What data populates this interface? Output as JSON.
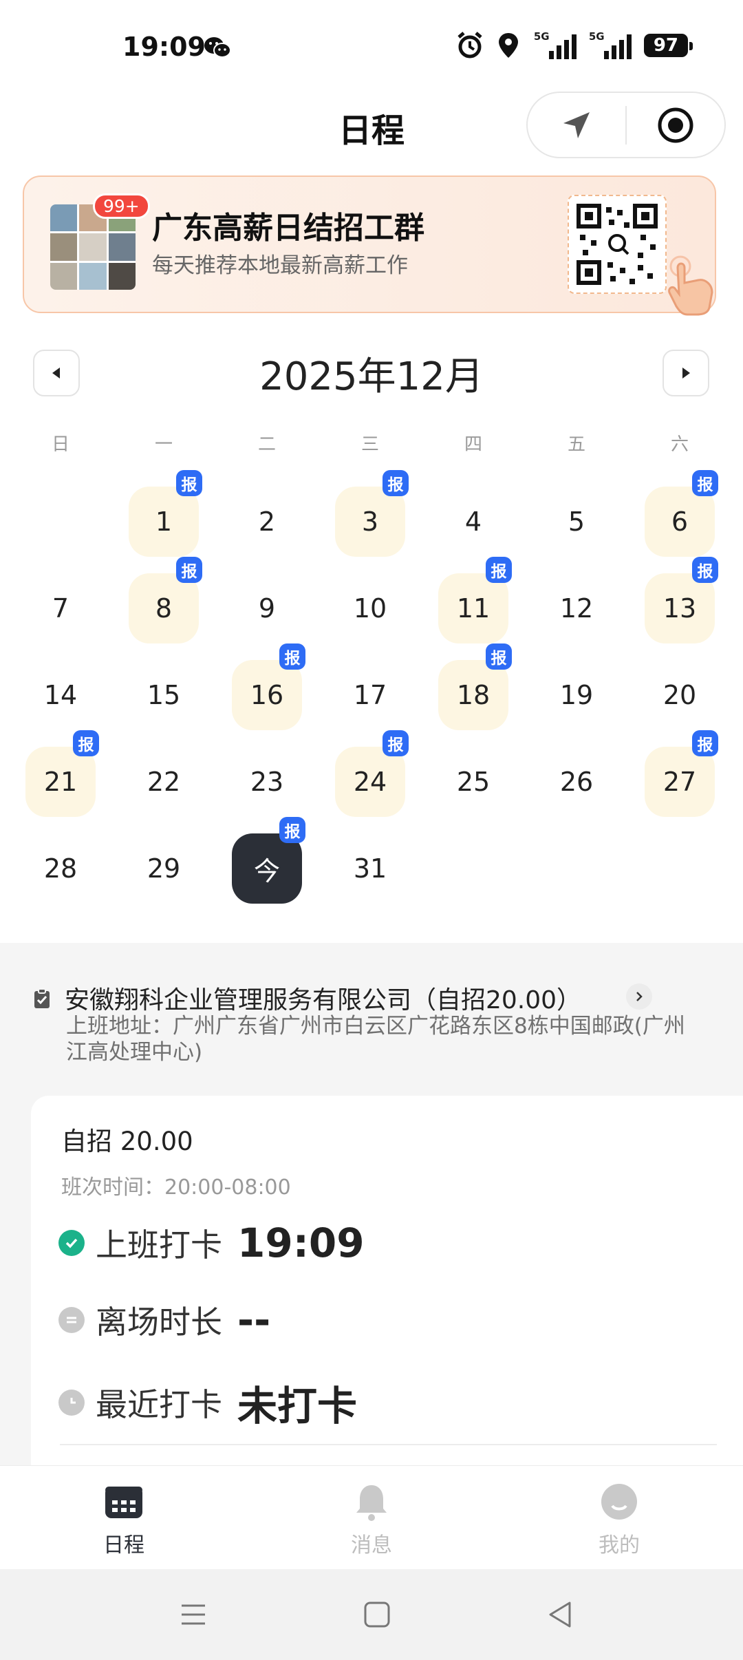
{
  "status_bar": {
    "time": "19:09",
    "icons": [
      "wechat-icon",
      "alarm-icon",
      "location-icon",
      "signal-5g-icon",
      "signal-5g-icon"
    ],
    "network_1": "5G",
    "network_2": "5G",
    "battery": "97"
  },
  "header": {
    "title": "日程",
    "capsule_icons": [
      "navigation-arrow-icon",
      "record-target-icon"
    ]
  },
  "banner": {
    "badge": "99+",
    "title": "广东高薪日结招工群",
    "subtitle": "每天推荐本地最新高薪工作",
    "qr_icon": "qr-code-icon",
    "hand_icon": "pointing-hand-icon"
  },
  "calendar": {
    "month_label": "2025年12月",
    "prev_icon": "triangle-left-icon",
    "next_icon": "triangle-right-icon",
    "weekdays": [
      "日",
      "一",
      "二",
      "三",
      "四",
      "五",
      "六"
    ],
    "badge_label": "报",
    "today_label": "今",
    "days": [
      {
        "label": "1",
        "report": true
      },
      {
        "label": "2",
        "report": false
      },
      {
        "label": "3",
        "report": true
      },
      {
        "label": "4",
        "report": false
      },
      {
        "label": "5",
        "report": false
      },
      {
        "label": "6",
        "report": true
      },
      {
        "label": "7",
        "report": false
      },
      {
        "label": "8",
        "report": true
      },
      {
        "label": "9",
        "report": false
      },
      {
        "label": "10",
        "report": false
      },
      {
        "label": "11",
        "report": true
      },
      {
        "label": "12",
        "report": false
      },
      {
        "label": "13",
        "report": true
      },
      {
        "label": "14",
        "report": false
      },
      {
        "label": "15",
        "report": false
      },
      {
        "label": "16",
        "report": true
      },
      {
        "label": "17",
        "report": false
      },
      {
        "label": "18",
        "report": true
      },
      {
        "label": "19",
        "report": false
      },
      {
        "label": "20",
        "report": false
      },
      {
        "label": "21",
        "report": true
      },
      {
        "label": "22",
        "report": false
      },
      {
        "label": "23",
        "report": false
      },
      {
        "label": "24",
        "report": true
      },
      {
        "label": "25",
        "report": false
      },
      {
        "label": "26",
        "report": false
      },
      {
        "label": "27",
        "report": true
      },
      {
        "label": "28",
        "report": false
      },
      {
        "label": "29",
        "report": false
      },
      {
        "label": "今",
        "report": true,
        "today": true
      },
      {
        "label": "31",
        "report": false
      }
    ]
  },
  "company": {
    "name": "安徽翔科企业管理服务有限公司（自招20.00）",
    "address": "上班地址：广州广东省广州市白云区广花路东区8栋中国邮政(广州江高处理中心)"
  },
  "card": {
    "title": "自招 20.00",
    "shift": "班次时间：20:00-08:00",
    "rows": [
      {
        "label": "上班打卡",
        "value": "19:09",
        "icon": "check-circle-icon",
        "color": "#1bb28a"
      },
      {
        "label": "离场时长",
        "value": "--",
        "icon": "exit-circle-icon",
        "color": "#c9c9c9"
      },
      {
        "label": "最近打卡",
        "value": "未打卡",
        "icon": "clock-icon",
        "color": "#c9c9c9"
      }
    ]
  },
  "tabbar": {
    "tabs": [
      {
        "label": "日程",
        "icon": "calendar-icon",
        "active": true
      },
      {
        "label": "消息",
        "icon": "bell-icon",
        "active": false
      },
      {
        "label": "我的",
        "icon": "profile-icon",
        "active": false
      }
    ]
  },
  "colors": {
    "accent_dark": "#2b2f37",
    "badge_blue": "#2e6cf5",
    "day_highlight": "#fdf6e2",
    "check_green": "#1bb28a",
    "banner_border": "#f7c6a8"
  }
}
